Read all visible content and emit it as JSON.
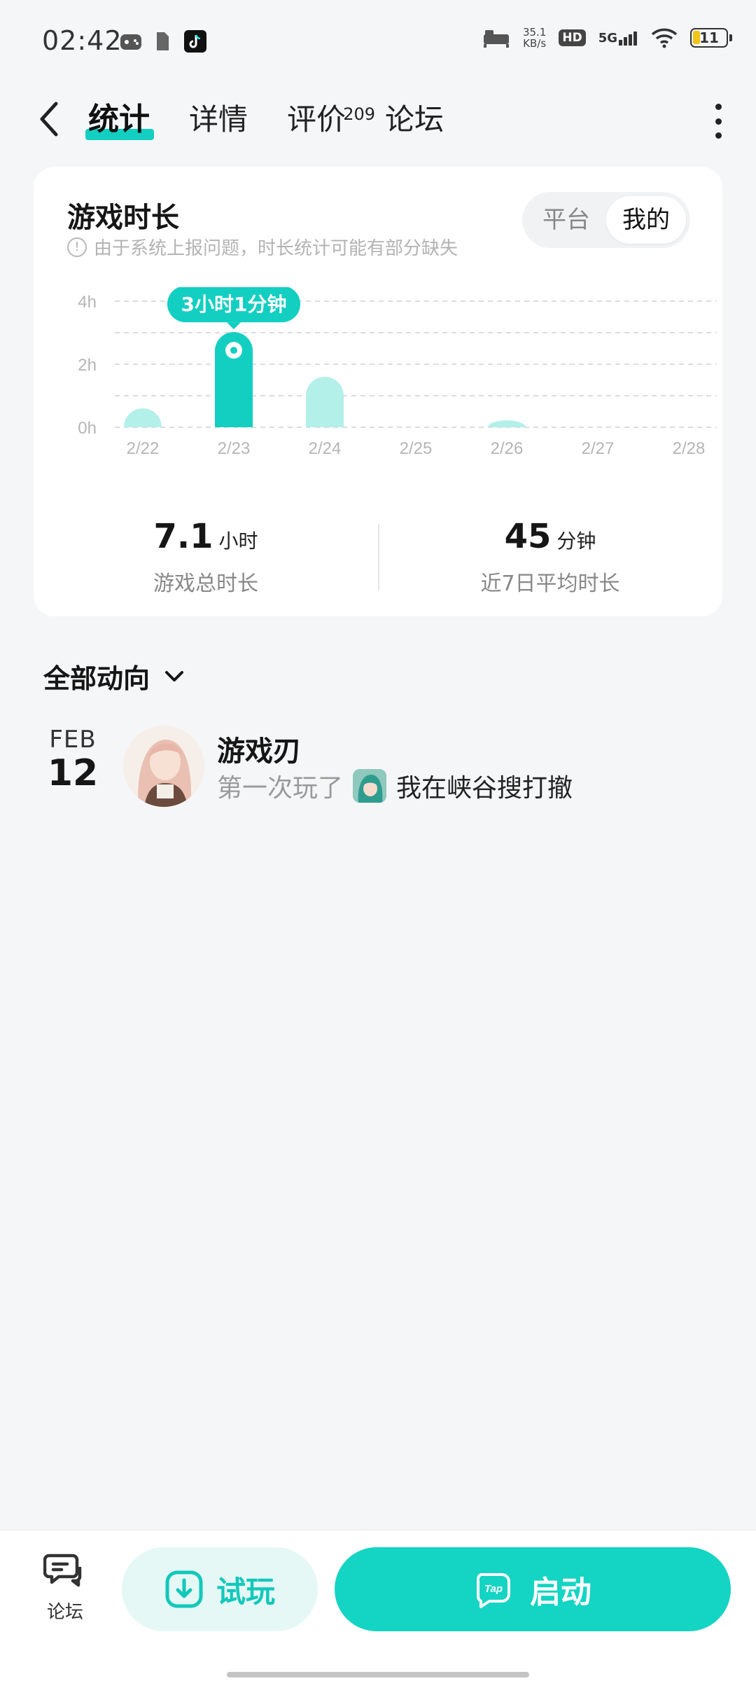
{
  "status_bar": {
    "time": "02:42",
    "net_speed_value": "35.1",
    "net_speed_unit": "KB/s",
    "hd_label": "HD",
    "network": "5G",
    "battery": "11"
  },
  "nav": {
    "tabs": [
      {
        "label": "统计",
        "active": true
      },
      {
        "label": "详情",
        "active": false
      },
      {
        "label": "评价",
        "active": false,
        "badge": "209"
      },
      {
        "label": "论坛",
        "active": false
      }
    ]
  },
  "stats": {
    "title": "游戏时长",
    "notice": "由于系统上报问题，时长统计可能有部分缺失",
    "toggle": [
      {
        "label": "平台",
        "selected": false
      },
      {
        "label": "我的",
        "selected": true
      }
    ],
    "total_value": "7.1",
    "total_unit": "小时",
    "total_label": "游戏总时长",
    "avg_value": "45",
    "avg_unit": "分钟",
    "avg_label": "近7日平均时长"
  },
  "chart_data": {
    "type": "bar",
    "categories": [
      "2/22",
      "2/23",
      "2/24",
      "2/25",
      "2/26",
      "2/27",
      "2/28"
    ],
    "values": [
      0.6,
      3.02,
      1.6,
      0,
      0.22,
      0,
      0
    ],
    "ylim": [
      0,
      4
    ],
    "yticks": [
      "0h",
      "2h",
      "4h"
    ],
    "highlight_index": 1,
    "highlight_label": "3小时1分钟",
    "colors": {
      "highlight": "#12cfc1",
      "normal": "#b3f0ea",
      "tick": "#b5b5b5"
    }
  },
  "activity": {
    "header": "全部动向",
    "items": [
      {
        "month": "FEB",
        "day": "12",
        "name": "游戏刃",
        "action": "第一次玩了",
        "game": "我在峡谷搜打撤"
      }
    ]
  },
  "bottom_bar": {
    "forum_label": "论坛",
    "try_label": "试玩",
    "launch_label": "启动",
    "tap_logo": "Tap"
  }
}
